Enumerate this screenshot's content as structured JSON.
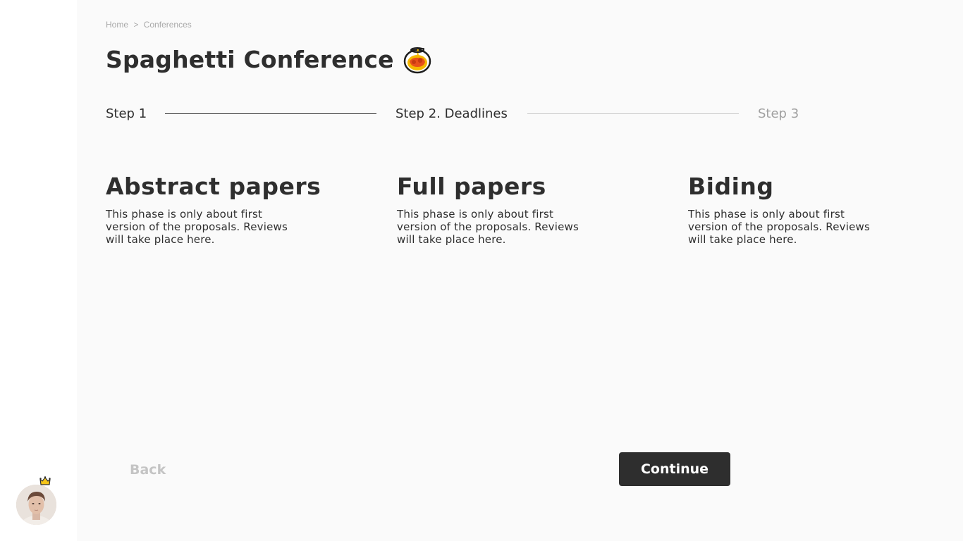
{
  "breadcrumb": {
    "items": [
      "Home",
      "Conferences"
    ],
    "separator": ">"
  },
  "page": {
    "title": "Spaghetti Conference",
    "title_icon": "spaghetti-bowl-icon"
  },
  "stepper": {
    "steps": [
      {
        "label": "Step 1",
        "state": "completed"
      },
      {
        "label": "Step 2. Deadlines",
        "state": "current"
      },
      {
        "label": "Step 3",
        "state": "upcoming"
      }
    ]
  },
  "phases": [
    {
      "title": "Abstract papers",
      "description": "This phase is only about first version of the proposals. Reviews will take place here."
    },
    {
      "title": "Full papers",
      "description": "This phase is only about first version of the proposals. Reviews will take place here."
    },
    {
      "title": "Biding",
      "description": "This phase is only about first version of the proposals. Reviews will take place here."
    }
  ],
  "actions": {
    "back_label": "Back",
    "continue_label": "Continue"
  },
  "user": {
    "avatar_icon": "user-avatar",
    "badge_icon": "crown-icon"
  },
  "colors": {
    "text": "#2e2e2e",
    "muted": "#a0a0a0",
    "disabled": "#c4c4c4",
    "primary_button": "#2e2e2e",
    "background": "#fafafa"
  }
}
